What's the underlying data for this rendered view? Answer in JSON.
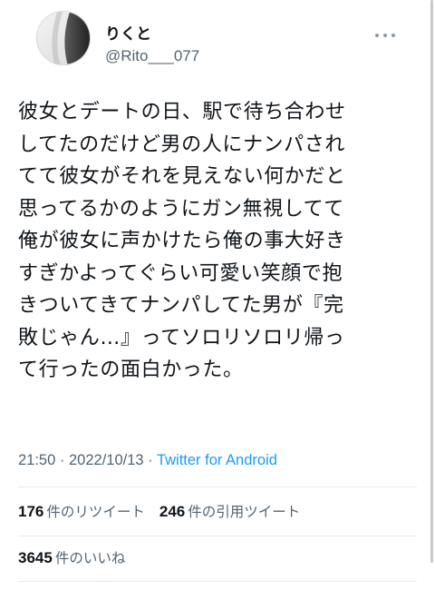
{
  "tweet": {
    "user": {
      "display_name": "りくと",
      "handle": "@Rito___077"
    },
    "text_lines": [
      "彼女とデートの日、駅で待ち合わせ",
      "してたのだけど男の人にナンパされ",
      "てて彼女がそれを見えない何かだと",
      "思ってるかのようにガン無視してて",
      "俺が彼女に声かけたら俺の事大好き",
      "すぎかよってぐらい可愛い笑顔で抱",
      "きついてきてナンパしてた男が『完",
      "敗じゃん…』ってソロリソロリ帰っ",
      "て行ったの面白かった。"
    ],
    "time": "21:50",
    "date": "2022/10/13",
    "separator": "·",
    "source": "Twitter for Android",
    "stats": {
      "retweets": {
        "count": "176",
        "label": "件のリツイート"
      },
      "quotes": {
        "count": "246",
        "label": "件の引用ツイート"
      },
      "likes": {
        "count": "3645",
        "label": "件のいいね"
      }
    }
  },
  "icons": {
    "more": "more-horizontal-icon",
    "avatar": "avatar-image"
  },
  "colors": {
    "text": "#0f1419",
    "secondary": "#536471",
    "link": "#1d9bf0",
    "divider": "#e6e9ec"
  }
}
